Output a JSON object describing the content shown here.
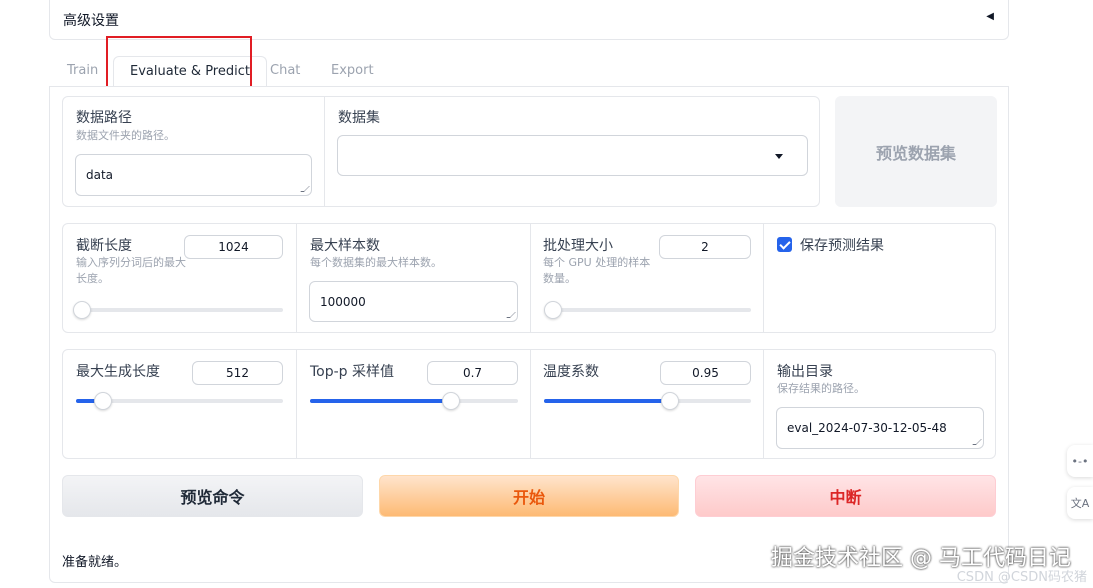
{
  "advanced": {
    "title": "高级设置",
    "caret": "◀"
  },
  "tabs": [
    {
      "label": "Train"
    },
    {
      "label": "Evaluate & Predict"
    },
    {
      "label": "Chat"
    },
    {
      "label": "Export"
    }
  ],
  "dataset_row": {
    "data_path": {
      "label": "数据路径",
      "info": "数据文件夹的路径。",
      "value": "data"
    },
    "dataset": {
      "label": "数据集",
      "value": ""
    },
    "preview_dataset_button": "预览数据集"
  },
  "row2": {
    "cutoff_len": {
      "label": "截断长度",
      "info": "输入序列分词后的最大长度。",
      "value": "1024",
      "slider_fraction": 0.03
    },
    "max_samples": {
      "label": "最大样本数",
      "info": "每个数据集的最大样本数。",
      "value": "100000"
    },
    "batch_size": {
      "label": "批处理大小",
      "info": "每个 GPU 处理的样本数量。",
      "value": "2",
      "slider_fraction": 0.0
    },
    "predict": {
      "label": "保存预测结果",
      "checked": true
    }
  },
  "row3": {
    "max_new_tokens": {
      "label": "最大生成长度",
      "value": "512",
      "slider_fraction": 0.13
    },
    "top_p": {
      "label": "Top-p 采样值",
      "value": "0.7",
      "slider_fraction": 0.68
    },
    "temperature": {
      "label": "温度系数",
      "value": "0.95",
      "slider_fraction": 0.61
    },
    "output_dir": {
      "label": "输出目录",
      "info": "保存结果的路径。",
      "value": "eval_2024-07-30-12-05-48"
    }
  },
  "buttons": {
    "preview_cmd": "预览命令",
    "start": "开始",
    "stop": "中断"
  },
  "status": "准备就绪。",
  "watermark": {
    "main": "掘金技术社区 @ 马工代码日记",
    "sub": "CSDN @CSDN码农猪"
  },
  "side_icons": [
    "•-•",
    "文A"
  ]
}
